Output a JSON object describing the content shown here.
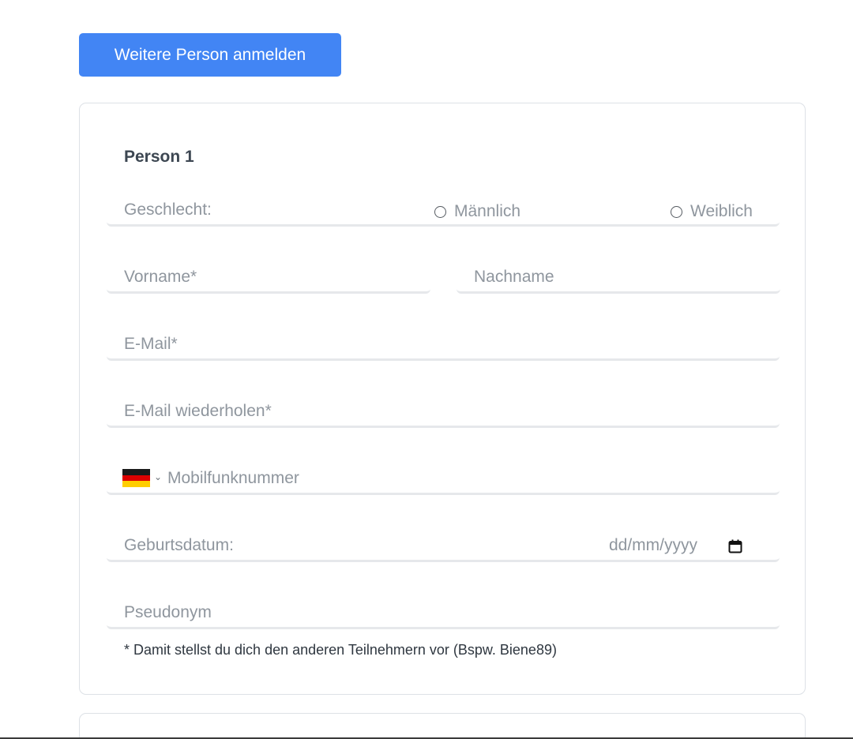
{
  "add_person_button": "Weitere Person anmelden",
  "person": {
    "title": "Person 1",
    "gender": {
      "label": "Geschlecht:",
      "options": [
        "Männlich",
        "Weiblich"
      ]
    },
    "first_name_placeholder": "Vorname*",
    "last_name_placeholder": "Nachname",
    "email_placeholder": "E-Mail*",
    "email_repeat_placeholder": "E-Mail wiederholen*",
    "phone": {
      "country_flag": "flag-germany-icon",
      "placeholder": "Mobilfunknummer"
    },
    "birthdate": {
      "label": "Geburtsdatum:",
      "placeholder": "dd/mm/yyyy"
    },
    "pseudonym_placeholder": "Pseudonym",
    "pseudonym_hint": "* Damit stellst du dich den anderen Teilnehmern vor (Bspw. Biene89)"
  },
  "colors": {
    "primary": "#4285f4",
    "placeholder": "#8f969e",
    "border": "#e6e8eb"
  }
}
